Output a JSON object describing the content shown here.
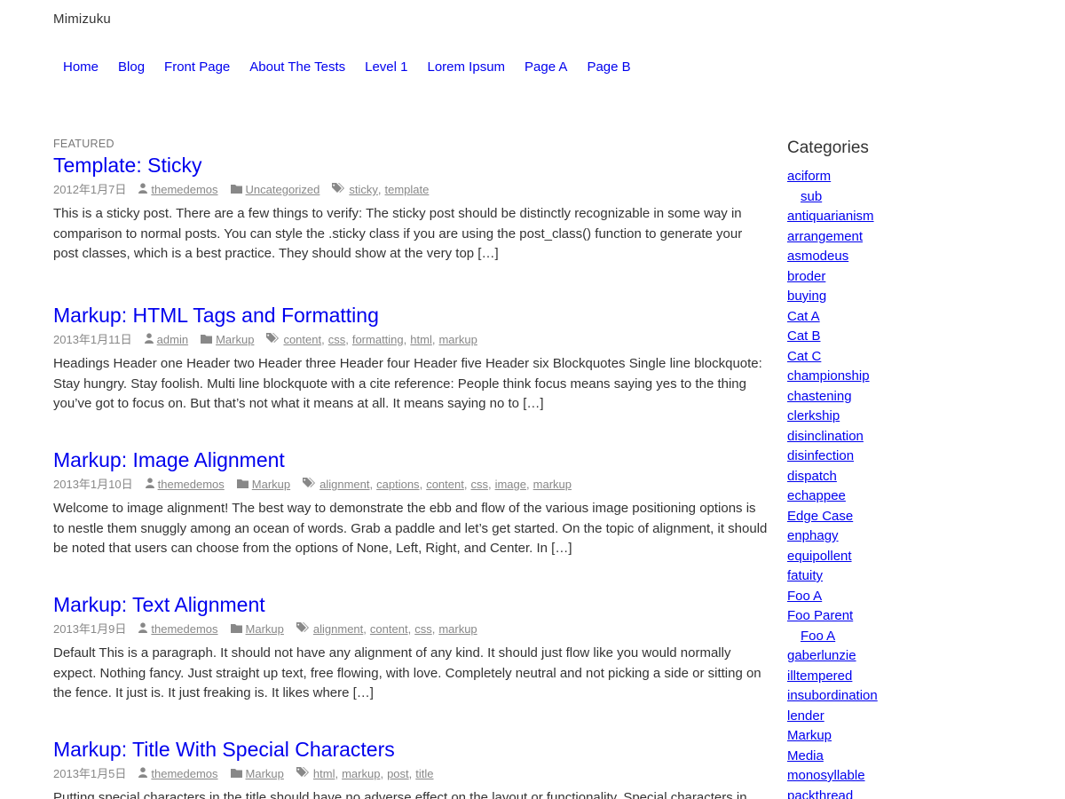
{
  "site": {
    "title": "Mimizuku"
  },
  "nav": {
    "items": [
      "Home",
      "Blog",
      "Front Page",
      "About The Tests",
      "Level 1",
      "Lorem Ipsum",
      "Page A",
      "Page B"
    ]
  },
  "posts": [
    {
      "featured": "FEATURED",
      "title": "Template: Sticky",
      "date": "2012年1月7日",
      "author": "themedemos",
      "category": "Uncategorized",
      "tags": [
        "sticky",
        "template"
      ],
      "excerpt": "This is a sticky post. There are a few things to verify: The sticky post should be distinctly recognizable in some way in comparison to normal posts. You can style the .sticky class if you are using the post_class() function to generate your post classes, which is a best practice. They should show at the very top […]"
    },
    {
      "title": "Markup: HTML Tags and Formatting",
      "date": "2013年1月11日",
      "author": "admin",
      "category": "Markup",
      "tags": [
        "content",
        "css",
        "formatting",
        "html",
        "markup"
      ],
      "excerpt": "Headings Header one Header two Header three Header four Header five Header six Blockquotes Single line blockquote: Stay hungry. Stay foolish. Multi line blockquote with a cite reference: People think focus means saying yes to the thing you’ve got to focus on. But that’s not what it means at all. It means saying no to […]"
    },
    {
      "title": "Markup: Image Alignment",
      "date": "2013年1月10日",
      "author": "themedemos",
      "category": "Markup",
      "tags": [
        "alignment",
        "captions",
        "content",
        "css",
        "image",
        "markup"
      ],
      "excerpt": "Welcome to image alignment! The best way to demonstrate the ebb and flow of the various image positioning options is to nestle them snuggly among an ocean of words. Grab a paddle and let’s get started. On the topic of alignment, it should be noted that users can choose from the options of None, Left, Right, and Center. In […]"
    },
    {
      "title": "Markup: Text Alignment",
      "date": "2013年1月9日",
      "author": "themedemos",
      "category": "Markup",
      "tags": [
        "alignment",
        "content",
        "css",
        "markup"
      ],
      "excerpt": "Default This is a paragraph. It should not have any alignment of any kind. It should just flow like you would normally expect. Nothing fancy. Just straight up text, free flowing, with love. Completely neutral and not picking a side or sitting on the fence. It just is. It just freaking is. It likes where […]"
    },
    {
      "title": "Markup: Title With Special Characters",
      "date": "2013年1月5日",
      "author": "themedemos",
      "category": "Markup",
      "tags": [
        "html",
        "markup",
        "post",
        "title"
      ],
      "excerpt": "Putting special characters in the title should have no adverse effect on the layout or functionality. Special characters in"
    }
  ],
  "sidebar": {
    "heading": "Categories",
    "categories": [
      {
        "label": "aciform",
        "child": false
      },
      {
        "label": "sub",
        "child": true
      },
      {
        "label": "antiquarianism",
        "child": false
      },
      {
        "label": "arrangement",
        "child": false
      },
      {
        "label": "asmodeus",
        "child": false
      },
      {
        "label": "broder",
        "child": false
      },
      {
        "label": "buying",
        "child": false
      },
      {
        "label": "Cat A",
        "child": false
      },
      {
        "label": "Cat B",
        "child": false
      },
      {
        "label": "Cat C",
        "child": false
      },
      {
        "label": "championship",
        "child": false
      },
      {
        "label": "chastening",
        "child": false
      },
      {
        "label": "clerkship",
        "child": false
      },
      {
        "label": "disinclination",
        "child": false
      },
      {
        "label": "disinfection",
        "child": false
      },
      {
        "label": "dispatch",
        "child": false
      },
      {
        "label": "echappee",
        "child": false
      },
      {
        "label": "Edge Case",
        "child": false
      },
      {
        "label": "enphagy",
        "child": false
      },
      {
        "label": "equipollent",
        "child": false
      },
      {
        "label": "fatuity",
        "child": false
      },
      {
        "label": "Foo A",
        "child": false
      },
      {
        "label": "Foo Parent",
        "child": false
      },
      {
        "label": "Foo A",
        "child": true
      },
      {
        "label": "gaberlunzie",
        "child": false
      },
      {
        "label": "illtempered",
        "child": false
      },
      {
        "label": "insubordination",
        "child": false
      },
      {
        "label": "lender",
        "child": false
      },
      {
        "label": "Markup",
        "child": false
      },
      {
        "label": "Media",
        "child": false
      },
      {
        "label": "monosyllable",
        "child": false
      },
      {
        "label": "packthread",
        "child": false
      }
    ]
  },
  "icons": {
    "author": "user-icon",
    "category": "folder-icon",
    "tags": "tags-icon"
  },
  "colors": {
    "link": "#0000ee",
    "meta": "#888888",
    "text": "#333333"
  }
}
